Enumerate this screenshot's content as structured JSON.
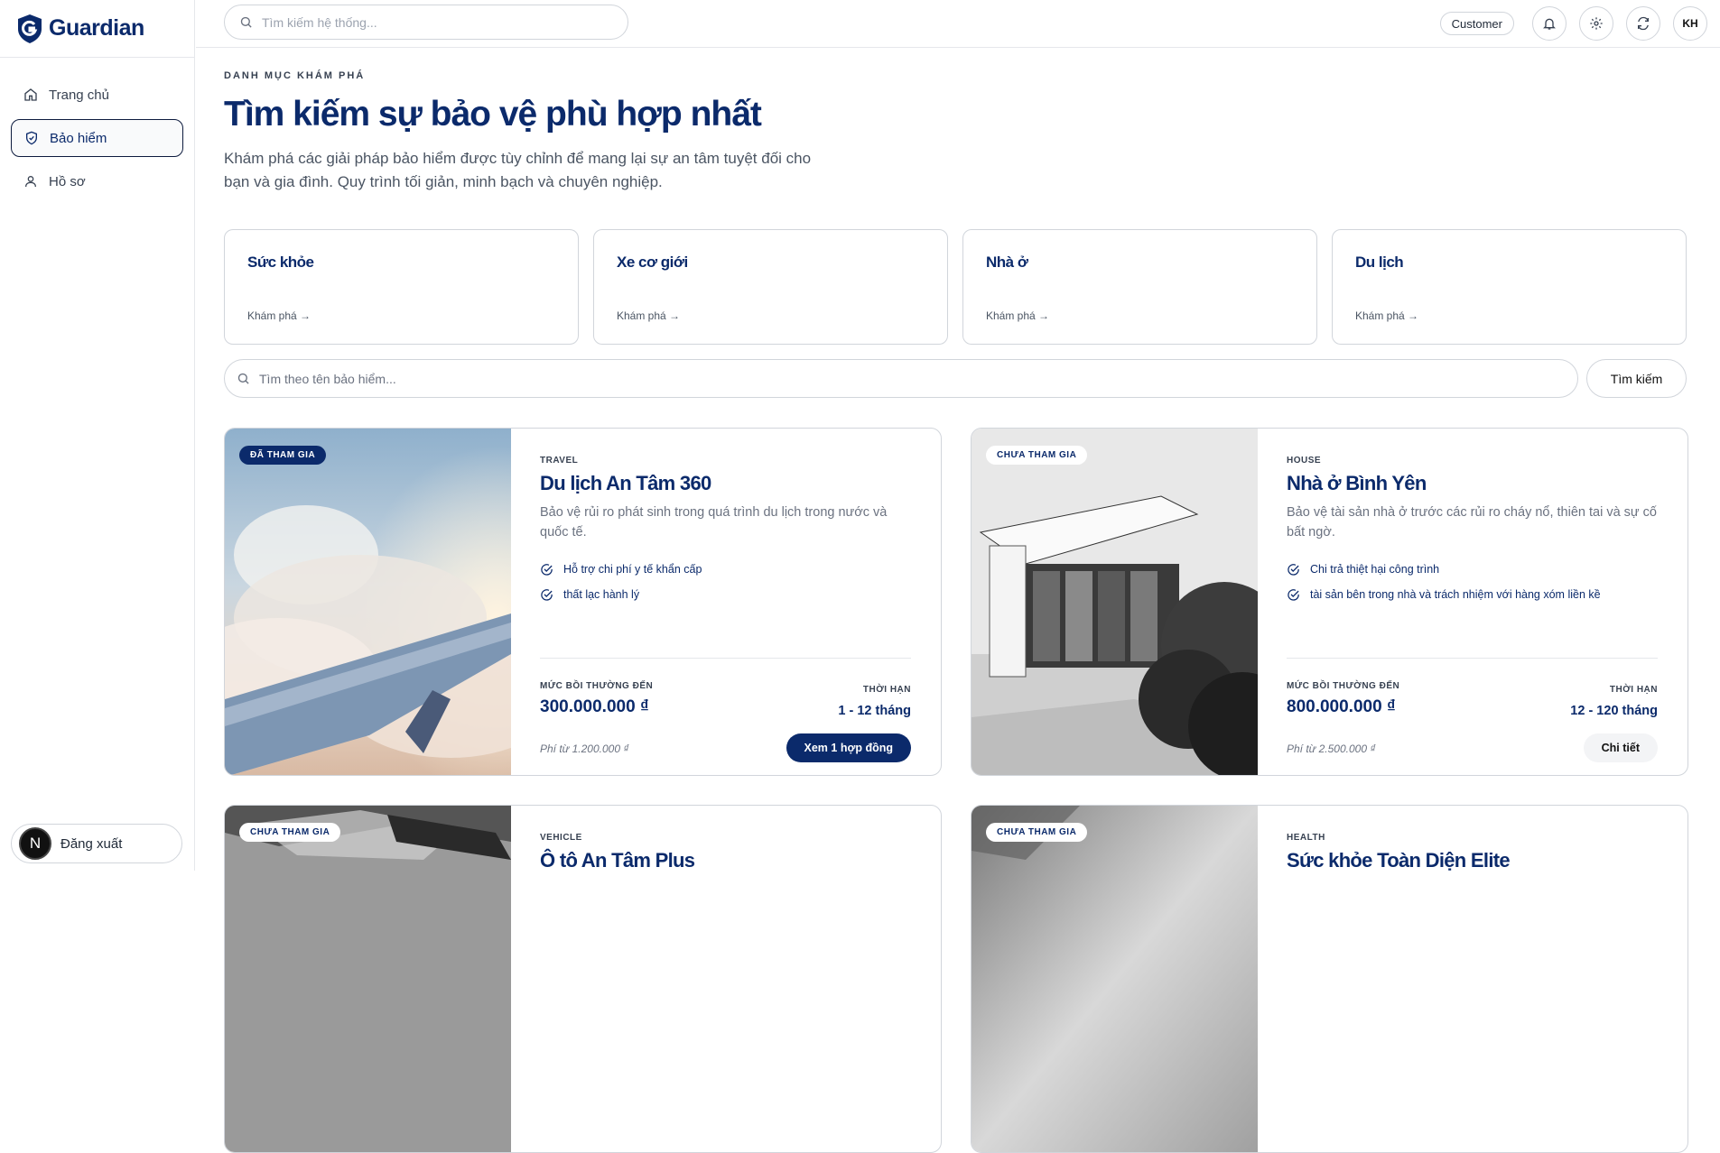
{
  "app": {
    "name": "Guardian"
  },
  "sidebar": {
    "items": [
      {
        "label": "Trang chủ",
        "icon": "home-icon",
        "active": false
      },
      {
        "label": "Bảo hiểm",
        "icon": "shield-icon",
        "active": true
      },
      {
        "label": "Hồ sơ",
        "icon": "user-icon",
        "active": false
      }
    ],
    "logout": {
      "badge": "N",
      "label": "Đăng xuất"
    }
  },
  "topbar": {
    "search_placeholder": "Tìm kiếm hệ thống...",
    "role": "Customer",
    "avatar": "KH"
  },
  "page": {
    "eyebrow": "DANH MỤC KHÁM PHÁ",
    "title": "Tìm kiếm sự bảo vệ phù hợp nhất",
    "desc_line1": "Khám phá các giải pháp bảo hiểm được tùy chỉnh để mang lại sự an tâm tuyệt đối cho",
    "desc_line2": "bạn và gia đình. Quy trình tối giản, minh bạch và chuyên nghiệp."
  },
  "categories": [
    {
      "name": "Sức khỏe",
      "link": "Khám phá →"
    },
    {
      "name": "Xe cơ giới",
      "link": "Khám phá →"
    },
    {
      "name": "Nhà ở",
      "link": "Khám phá →"
    },
    {
      "name": "Du lịch",
      "link": "Khám phá →"
    }
  ],
  "search": {
    "placeholder": "Tìm theo tên bảo hiểm...",
    "button": "Tìm kiếm"
  },
  "products": [
    {
      "badge": "ĐÃ THAM GIA",
      "type": "TRAVEL",
      "name": "Du lịch An Tâm 360",
      "desc": "Bảo vệ rủi ro phát sinh trong quá trình du lịch trong nước và quốc tế.",
      "features": [
        "Hỗ trợ chi phí y tế khẩn cấp",
        "thất lạc hành lý"
      ],
      "coverage_label": "MỨC BỒI THƯỜNG ĐẾN",
      "coverage": "300.000.000 ₫",
      "term_label": "THỜI HẠN",
      "term": "1 - 12 tháng",
      "fee": "Phí từ 1.200.000 ₫",
      "button": "Xem 1 hợp đồng"
    },
    {
      "badge": "CHƯA THAM GIA",
      "type": "HOUSE",
      "name": "Nhà ở Bình Yên",
      "desc": "Bảo vệ tài sản nhà ở trước các rủi ro cháy nổ, thiên tai và sự cố bất ngờ.",
      "features": [
        "Chi trả thiệt hại công trình",
        "tài sản bên trong nhà và trách nhiệm với hàng xóm liền kề"
      ],
      "coverage_label": "MỨC BỒI THƯỜNG ĐẾN",
      "coverage": "800.000.000 ₫",
      "term_label": "THỜI HẠN",
      "term": "12 - 120 tháng",
      "fee": "Phí từ 2.500.000 ₫",
      "button": "Chi tiết"
    },
    {
      "badge": "CHƯA THAM GIA",
      "type": "VEHICLE",
      "name": "Ô tô An Tâm Plus"
    },
    {
      "badge": "CHƯA THAM GIA",
      "type": "HEALTH",
      "name": "Sức khỏe Toàn Diện Elite"
    }
  ],
  "colors": {
    "brand": "#0b2a6b",
    "text": "#0d1b3e",
    "border": "#d1d5db"
  }
}
